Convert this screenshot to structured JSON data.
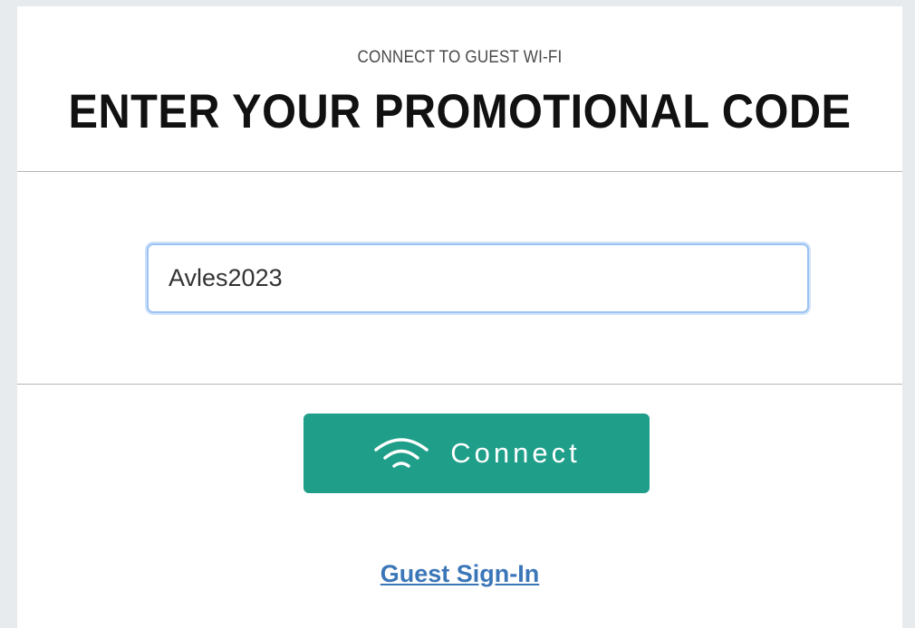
{
  "header": {
    "subtitle": "CONNECT TO GUEST WI-FI",
    "title": "ENTER YOUR PROMOTIONAL CODE"
  },
  "form": {
    "code_value": "Avles2023"
  },
  "connect_button": {
    "label": "Connect",
    "icon": "wifi-icon",
    "color": "#1f9e89"
  },
  "guest_link": {
    "label": "Guest Sign-In",
    "color": "#3b76b8"
  }
}
